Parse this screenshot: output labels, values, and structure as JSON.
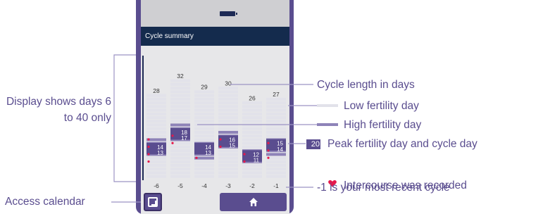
{
  "screen": {
    "title": "Cycle summary"
  },
  "annotations": {
    "display_note": "Display shows days 6 to 40 only",
    "cycle_length": "Cycle length in days",
    "low_fertility": "Low fertility day",
    "high_fertility": "High fertility day",
    "peak_fertility": "Peak fertility day and cycle day",
    "peak_example_day": "20",
    "intercourse": "Intercourse was recorded",
    "recent_cycle": "-1 is your most recent cycle",
    "access_calendar": "Access calendar"
  },
  "colors": {
    "accent": "#5a4d8f",
    "title_bar": "#142b4d",
    "low_fertility": "#e2e2ea",
    "high_fertility": "#8e83b8",
    "intercourse": "#e6194b"
  },
  "icons": {
    "calendar": "calendar-icon",
    "home": "home-icon",
    "battery": "battery-icon",
    "intercourse": "heart-icon"
  },
  "chart_data": {
    "type": "bar",
    "ylim": [
      6,
      40
    ],
    "cycles": [
      {
        "label": "-6",
        "length": 28,
        "high_days": [
          12,
          16
        ],
        "peak_days": [
          14,
          13
        ],
        "intercourse_days": [
          10,
          12,
          14,
          16
        ]
      },
      {
        "label": "-5",
        "length": 32,
        "high_days": [
          16,
          20
        ],
        "peak_days": [
          18,
          17
        ],
        "intercourse_days": [
          15,
          17
        ]
      },
      {
        "label": "-4",
        "length": 29,
        "high_days": [
          11,
          15
        ],
        "peak_days": [
          14,
          13
        ],
        "intercourse_days": [
          11
        ]
      },
      {
        "label": "-3",
        "length": 30,
        "high_days": [
          14,
          18
        ],
        "peak_days": [
          16,
          15
        ],
        "intercourse_days": [
          14,
          16
        ]
      },
      {
        "label": "-2",
        "length": 26,
        "high_days": [
          10,
          13
        ],
        "peak_days": [
          12,
          11
        ],
        "intercourse_days": [
          10,
          12
        ]
      },
      {
        "label": "-1",
        "length": 27,
        "high_days": [
          12,
          16
        ],
        "peak_days": [
          15,
          14
        ],
        "intercourse_days": [
          11,
          13,
          15
        ]
      }
    ]
  }
}
